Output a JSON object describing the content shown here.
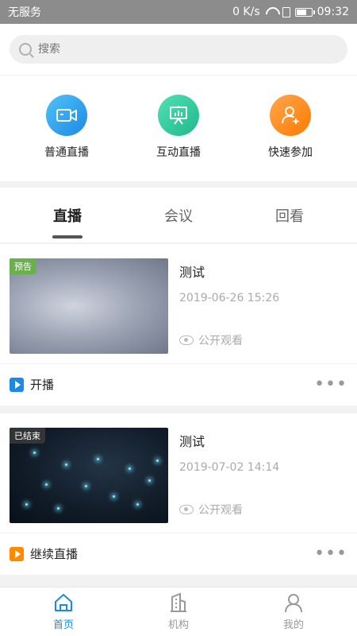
{
  "status": {
    "carrier": "无服务",
    "speed": "0 K/s",
    "time": "09:32"
  },
  "search": {
    "placeholder": "搜索"
  },
  "quick_actions": [
    {
      "label": "普通直播",
      "icon": "camera-icon",
      "color": "#1e88e5"
    },
    {
      "label": "互动直播",
      "icon": "presentation-icon",
      "color": "#22b78a"
    },
    {
      "label": "快速参加",
      "icon": "add-user-icon",
      "color": "#ff7a00"
    }
  ],
  "tabs": [
    {
      "label": "直播",
      "active": true
    },
    {
      "label": "会议",
      "active": false
    },
    {
      "label": "回看",
      "active": false
    }
  ],
  "cards": [
    {
      "badge": "预告",
      "title": "测试",
      "date": "2019-06-26 15:26",
      "visibility": "公开观看",
      "action": "开播"
    },
    {
      "badge": "已结束",
      "title": "测试",
      "date": "2019-07-02 14:14",
      "visibility": "公开观看",
      "action": "继续直播"
    }
  ],
  "bottom_nav": [
    {
      "label": "首页",
      "icon": "home-icon",
      "active": true
    },
    {
      "label": "机构",
      "icon": "building-icon",
      "active": false
    },
    {
      "label": "我的",
      "icon": "profile-icon",
      "active": false
    }
  ],
  "more_glyph": "•••"
}
